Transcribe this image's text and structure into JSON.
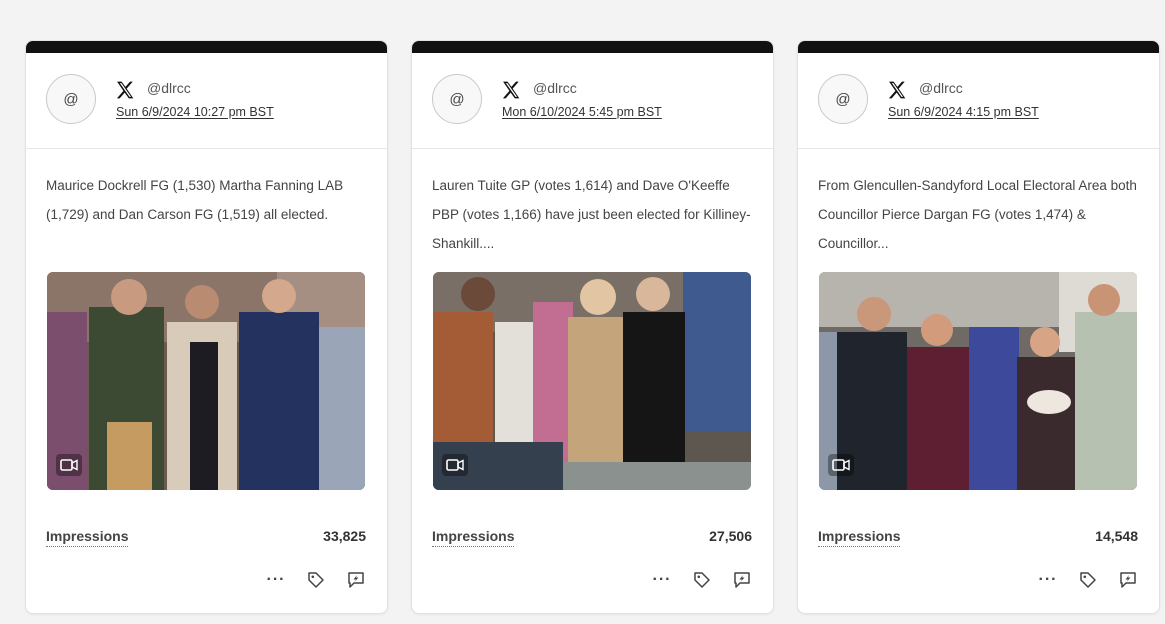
{
  "posts": [
    {
      "avatar": "@",
      "platform_icon": "x-logo-icon",
      "handle": "@dlrcc",
      "date": "Sun 6/9/2024 10:27 pm BST",
      "text": "Maurice Dockrell FG (1,530) Martha Fanning LAB (1,729) and Dan Carson FG (1,519) all elected.",
      "media_type": "video",
      "impressions_label": "Impressions",
      "impressions_value": "33,825",
      "more_label": "···"
    },
    {
      "avatar": "@",
      "platform_icon": "x-logo-icon",
      "handle": "@dlrcc",
      "date": "Mon 6/10/2024 5:45 pm BST",
      "text": "Lauren Tuite GP (votes 1,614) and Dave O'Keeffe PBP (votes 1,166) have just been elected for Killiney-Shankill....",
      "media_type": "video",
      "impressions_label": "Impressions",
      "impressions_value": "27,506",
      "more_label": "···"
    },
    {
      "avatar": "@",
      "platform_icon": "x-logo-icon",
      "handle": "@dlrcc",
      "date": "Sun 6/9/2024 4:15 pm BST",
      "text": "From Glencullen-Sandyford Local Electoral Area both Councillor Pierce Dargan FG (votes 1,474) & Councillor...",
      "media_type": "video",
      "impressions_label": "Impressions",
      "impressions_value": "14,548",
      "more_label": "···"
    }
  ],
  "icons": {
    "more": "more-dots-icon",
    "tag": "tag-icon",
    "boost": "boost-icon",
    "video": "video-camera-icon"
  },
  "colors": {
    "card_top_bar": "#111111",
    "page_background": "#f3f3f3",
    "card_background": "#ffffff"
  }
}
